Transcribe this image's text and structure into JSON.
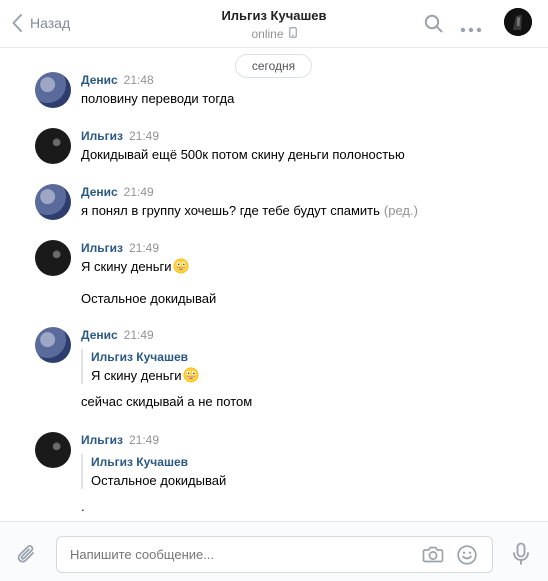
{
  "header": {
    "back_label": "Назад",
    "title": "Ильгиз Кучашев",
    "status": "online"
  },
  "date_separator": "сегодня",
  "messages": [
    {
      "author": "Денис",
      "time": "21:48",
      "text": "половину переводи тогда"
    },
    {
      "author": "Ильгиз",
      "time": "21:49",
      "text": "Докидывай ещё 500к потом скину деньги полоностью"
    },
    {
      "author": "Денис",
      "time": "21:49",
      "text": "я понял в группу хочешь? где тебе будут спамить",
      "edited": "(ред.)"
    },
    {
      "author": "Ильгиз",
      "time": "21:49",
      "text": "Я скину деньги",
      "text2": "Остальное докидывай"
    },
    {
      "author": "Денис",
      "time": "21:49",
      "quote_author": "Ильгиз Кучашев",
      "quote_text": "Я скину деньги",
      "text": "сейчас скидывай а не потом"
    },
    {
      "author": "Ильгиз",
      "time": "21:49",
      "quote_author": "Ильгиз Кучашев",
      "quote_text": "Остальное докидывай",
      "text": "."
    }
  ],
  "composer": {
    "placeholder": "Напишите сообщение..."
  },
  "colors": {
    "link": "#2a5885",
    "muted": "#939393",
    "icon": "#818c99"
  },
  "icons": [
    "chevron-left-icon",
    "phone-icon",
    "search-icon",
    "more-icon",
    "paperclip-icon",
    "camera-icon",
    "smile-icon",
    "microphone-icon",
    "grinning-emoji"
  ]
}
